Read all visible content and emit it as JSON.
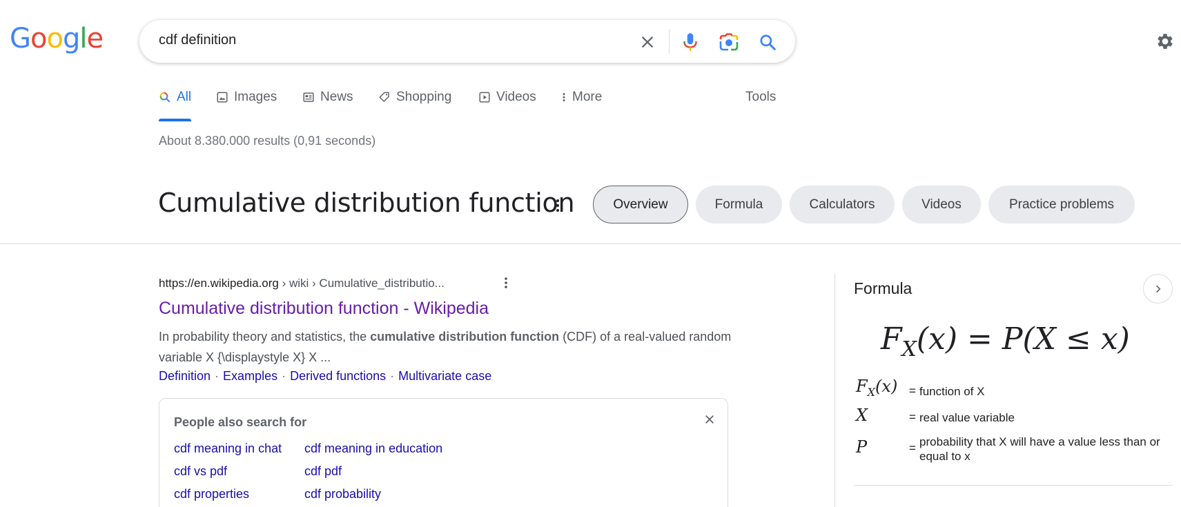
{
  "header": {
    "logo_letters": [
      "G",
      "o",
      "o",
      "g",
      "l",
      "e"
    ],
    "search_value": "cdf definition"
  },
  "tabs": [
    {
      "label": "All",
      "icon": "search-icon"
    },
    {
      "label": "Images",
      "icon": "image-icon"
    },
    {
      "label": "News",
      "icon": "news-icon"
    },
    {
      "label": "Shopping",
      "icon": "tag-icon"
    },
    {
      "label": "Videos",
      "icon": "play-icon"
    },
    {
      "label": "More",
      "icon": "more-vertical-icon"
    }
  ],
  "tools_label": "Tools",
  "result_stats": "About 8.380.000 results (0,91 seconds)",
  "topic": {
    "title": "Cumulative distribution function",
    "chips": [
      "Overview",
      "Formula",
      "Calculators",
      "Videos",
      "Practice problems"
    ],
    "selected_chip": "Overview"
  },
  "result": {
    "url_domain": "https://en.wikipedia.org",
    "url_path": " › wiki › Cumulative_distributio...",
    "title": "Cumulative distribution function - Wikipedia",
    "snippet_pre": "In probability theory and statistics, the ",
    "snippet_bold": "cumulative distribution function",
    "snippet_post": " (CDF) of a real-valued random variable X {\\displaystyle X} X ...",
    "sitelinks": [
      "Definition",
      "Examples",
      "Derived functions",
      "Multivariate case"
    ]
  },
  "people_also_search": {
    "title": "People also search for",
    "links": [
      "cdf meaning in chat",
      "cdf meaning in education",
      "cdf vs pdf",
      "cdf pdf",
      "cdf properties",
      "cdf probability"
    ]
  },
  "knowledge_panel": {
    "title": "Formula",
    "formula": {
      "lhs_F": "F",
      "lhs_sub": "X",
      "lhs_arg": "(x)",
      "eq": " = ",
      "rhs_P": "P",
      "rhs_arg": "(X ≤ x)"
    },
    "variables": [
      {
        "sym_main": "F",
        "sym_sub": "X",
        "sym_arg": "(x)",
        "eq": "=",
        "desc": "function of X"
      },
      {
        "sym_main": "X",
        "sym_sub": "",
        "sym_arg": "",
        "eq": "=",
        "desc": "real value variable"
      },
      {
        "sym_main": "P",
        "sym_sub": "",
        "sym_arg": "",
        "eq": "=",
        "desc": "probability that X will have a value less than or equal to x"
      }
    ]
  },
  "colors": {
    "blue": "#4285f4",
    "red": "#ea4335",
    "yellow": "#fbbc05",
    "green": "#34a853",
    "link": "#1a0dab",
    "visited": "#681da8",
    "active_tab": "#1a73e8"
  }
}
